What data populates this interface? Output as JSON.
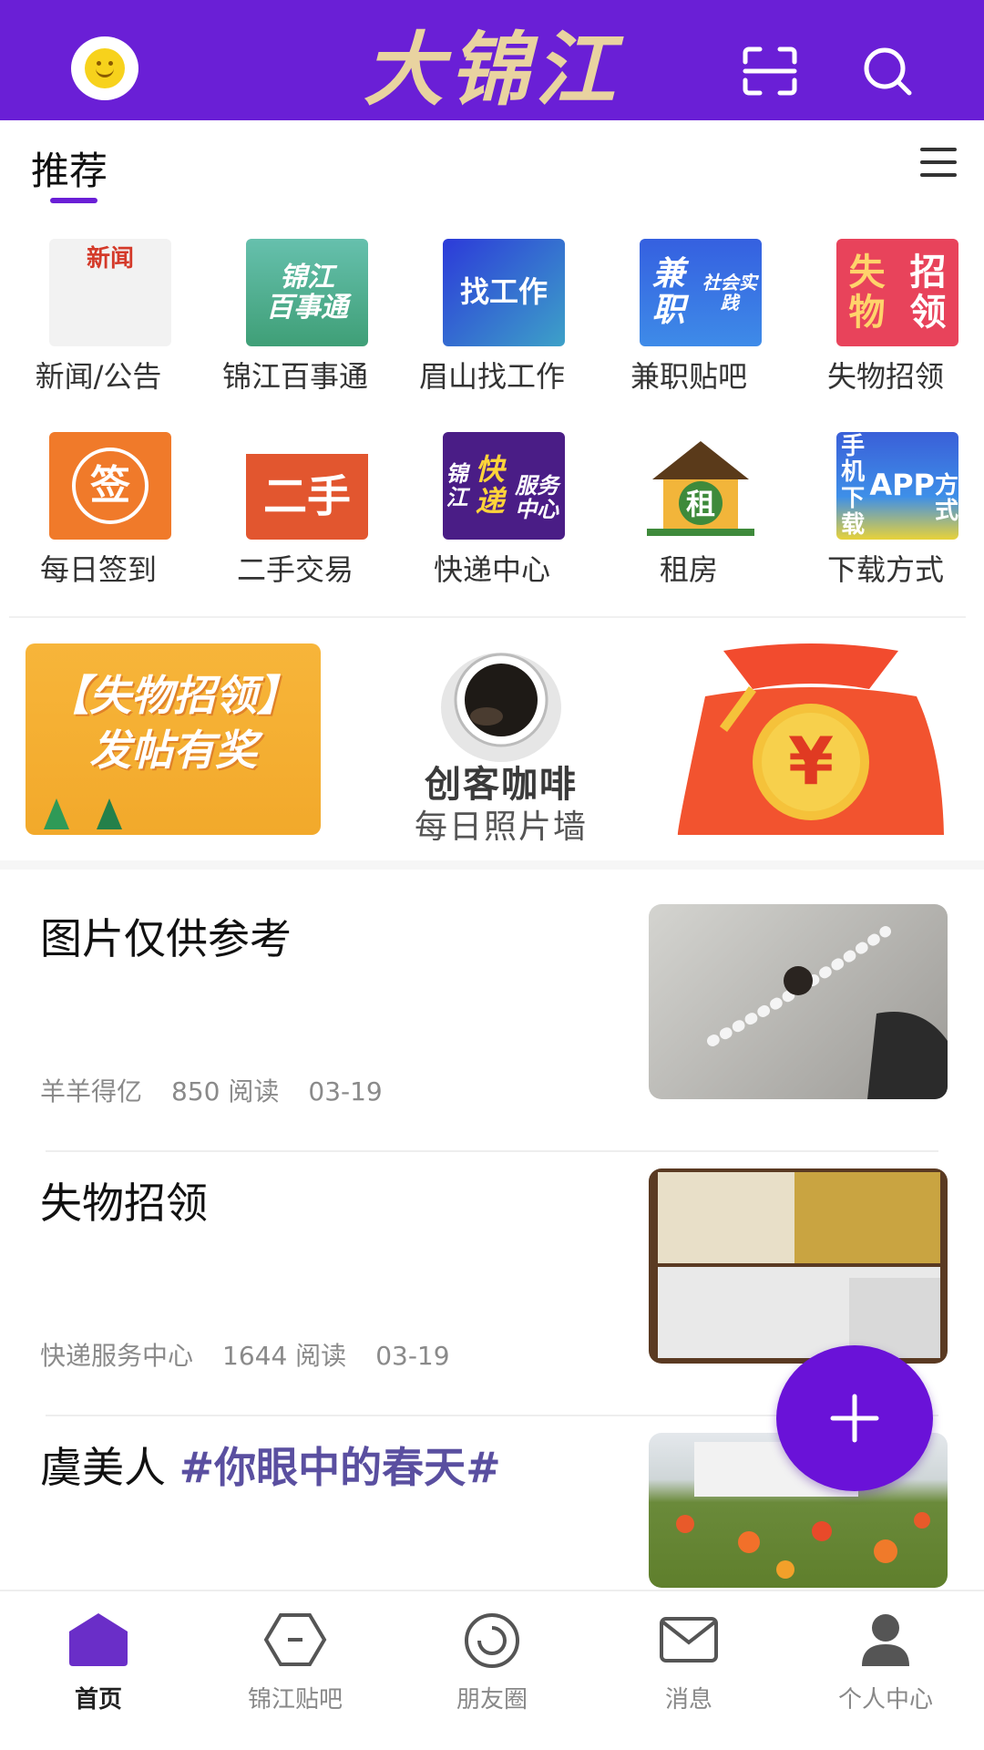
{
  "header": {
    "logo_text": "大锦江",
    "brand_color": "#6a1fd6",
    "icons": [
      "avatar",
      "scan-icon",
      "search-icon"
    ]
  },
  "tabs": {
    "active_label": "推荐"
  },
  "grid": {
    "items": [
      {
        "label": "新闻/公告",
        "icon_text": "新闻",
        "color": "#ffffff"
      },
      {
        "label": "锦江百事通",
        "icon_text": "锦江\n百事通",
        "color": "#3f9f77"
      },
      {
        "label": "眉山找工作",
        "icon_text": "找工作",
        "color": "#2f47d6"
      },
      {
        "label": "兼职贴吧",
        "icon_text": "兼职\n社会实践",
        "color": "#3a6ee8"
      },
      {
        "label": "失物招领",
        "icon_text": "失物\n招领",
        "color": "#e8435b"
      },
      {
        "label": "每日签到",
        "icon_text": "签",
        "color": "#f07a2a"
      },
      {
        "label": "二手交易",
        "icon_text": "二手",
        "color": "#e2562f"
      },
      {
        "label": "快递中心",
        "icon_text": "锦江快递\n服务中心",
        "color": "#4a1d86"
      },
      {
        "label": "租房",
        "icon_text": "租",
        "color": "#3e8a3b"
      },
      {
        "label": "下载方式",
        "icon_text": "手机下载\nAPP\n方式",
        "color": "#3a5fd8"
      }
    ]
  },
  "banners": {
    "lost_found_line1": "【失物招领】",
    "lost_found_line2": "发帖有奖",
    "coffee_title": "创客咖啡",
    "coffee_subtitle": "每日照片墙",
    "money_symbol": "¥"
  },
  "feed": [
    {
      "title": "图片仅供参考",
      "tag": "",
      "author": "羊羊得亿",
      "reads": "850 阅读",
      "date": "03-19"
    },
    {
      "title": "失物招领",
      "tag": "",
      "author": "快递服务中心",
      "reads": "1644 阅读",
      "date": "03-19"
    },
    {
      "title": "虞美人 ",
      "tag": "#你眼中的春天#",
      "author": "",
      "reads": "",
      "date": ""
    }
  ],
  "fab": {
    "symbol": "+"
  },
  "bottom_nav": {
    "items": [
      {
        "label": "首页",
        "icon": "home-icon",
        "active": true
      },
      {
        "label": "锦江贴吧",
        "icon": "forum-icon",
        "active": false
      },
      {
        "label": "朋友圈",
        "icon": "moments-icon",
        "active": false
      },
      {
        "label": "消息",
        "icon": "mail-icon",
        "active": false
      },
      {
        "label": "个人中心",
        "icon": "user-icon",
        "active": false
      }
    ]
  }
}
